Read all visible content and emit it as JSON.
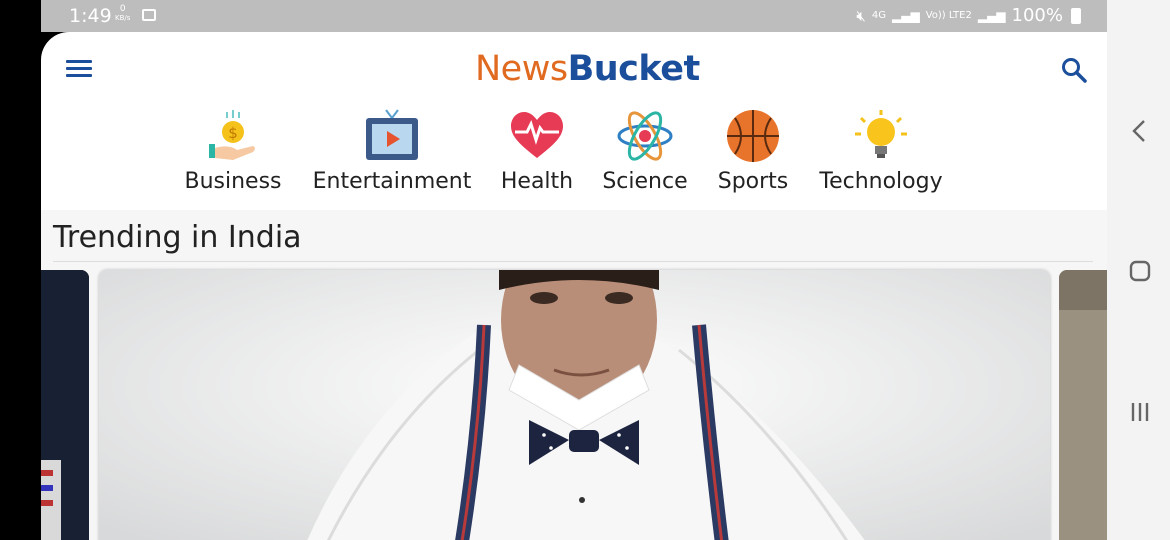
{
  "status_bar": {
    "time": "1:49",
    "data_rate_value": "0",
    "data_rate_unit": "KB/s",
    "network_label": "4G",
    "volte_label": "Vo)) LTE2",
    "battery": "100%"
  },
  "header": {
    "logo_part1": "News",
    "logo_part2": "Bucket"
  },
  "categories": [
    {
      "label": "Business",
      "icon": "money-hand-icon"
    },
    {
      "label": "Entertainment",
      "icon": "tv-icon"
    },
    {
      "label": "Health",
      "icon": "heart-pulse-icon"
    },
    {
      "label": "Science",
      "icon": "atom-icon"
    },
    {
      "label": "Sports",
      "icon": "basketball-icon"
    },
    {
      "label": "Technology",
      "icon": "lightbulb-icon"
    }
  ],
  "trending": {
    "title": "Trending in India"
  },
  "colors": {
    "brand_orange": "#e06a1f",
    "brand_blue": "#1b4f9b"
  }
}
